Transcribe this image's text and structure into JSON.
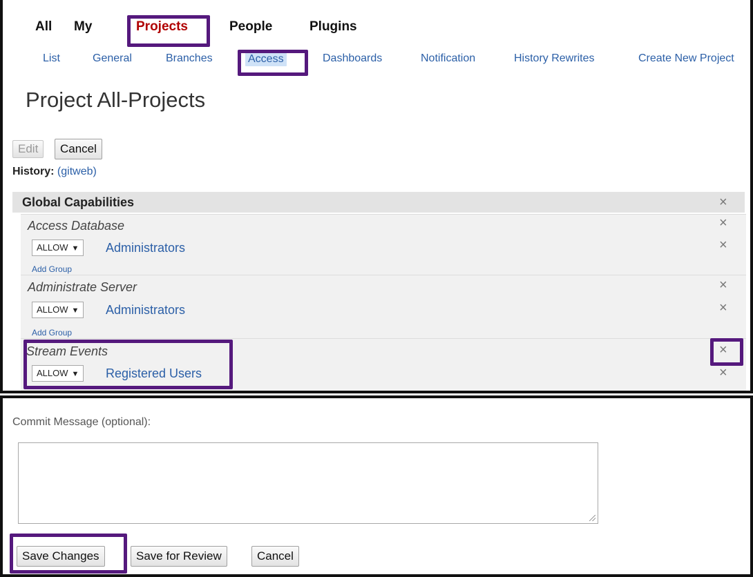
{
  "topnav": {
    "items": [
      "All",
      "My",
      "Projects",
      "People",
      "Plugins"
    ],
    "active": "Projects"
  },
  "subnav": {
    "items": [
      "List",
      "General",
      "Branches",
      "Access",
      "Dashboards",
      "Notification",
      "History Rewrites",
      "Create New Project"
    ],
    "active": "Access"
  },
  "page": {
    "title": "Project All-Projects"
  },
  "toolbar": {
    "edit_label": "Edit",
    "cancel_label": "Cancel"
  },
  "history": {
    "label": "History:",
    "link": "(gitweb)"
  },
  "capabilities": {
    "header": "Global Capabilities",
    "close_glyph": "×",
    "sections": [
      {
        "name": "Access Database",
        "rules": [
          {
            "action": "ALLOW",
            "group": "Administrators"
          }
        ],
        "add_group": "Add Group"
      },
      {
        "name": "Administrate Server",
        "rules": [
          {
            "action": "ALLOW",
            "group": "Administrators"
          }
        ],
        "add_group": "Add Group"
      },
      {
        "name": "Stream Events",
        "rules": [
          {
            "action": "ALLOW",
            "group": "Registered Users"
          }
        ]
      }
    ]
  },
  "commit": {
    "label": "Commit Message (optional):",
    "value": ""
  },
  "footer": {
    "save_label": "Save Changes",
    "review_label": "Save for Review",
    "cancel_label": "Cancel"
  },
  "icons": {
    "dropdown": "▼"
  },
  "colors": {
    "link": "#2b5fa7",
    "active_tab": "#b00000",
    "highlight": "#55197d",
    "active_subtab_bg": "#cfe2f7"
  }
}
